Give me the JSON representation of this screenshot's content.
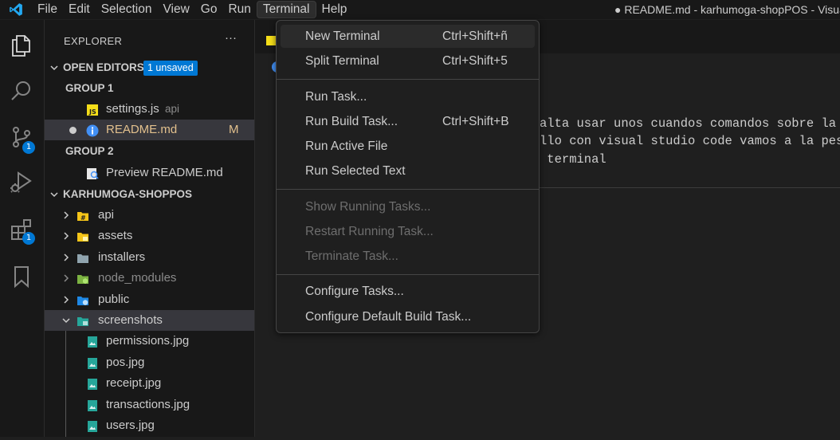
{
  "menubar": {
    "items": [
      "File",
      "Edit",
      "Selection",
      "View",
      "Go",
      "Run",
      "Terminal",
      "Help"
    ],
    "active": "Terminal"
  },
  "window_title": "● README.md - karhumoga-shopPOS - Visual Studio Code",
  "activity_bar": {
    "icons": [
      "explorer-icon",
      "search-icon",
      "source-control-icon",
      "run-debug-icon",
      "extensions-icon",
      "bookmarks-icon"
    ],
    "badges": {
      "source_control": "1",
      "extensions": "1"
    }
  },
  "explorer": {
    "title": "EXPLORER",
    "more": "···",
    "open_editors": {
      "label": "OPEN EDITORS",
      "badge": "1 unsaved",
      "group1": "GROUP 1",
      "group2": "GROUP 2",
      "files": [
        {
          "name": "settings.js",
          "desc": "api"
        },
        {
          "name": "README.md",
          "status": "M"
        },
        {
          "name": "Preview README.md"
        }
      ]
    },
    "project": {
      "label": "KARHUMOGA-SHOPPOS",
      "folders": [
        "api",
        "assets",
        "installers",
        "node_modules",
        "public",
        "screenshots"
      ],
      "files": [
        "permissions.jpg",
        "pos.jpg",
        "receipt.jpg",
        "transactions.jpg",
        "users.jpg"
      ]
    }
  },
  "editor": {
    "lines": [
      "alta usar unos cuandos comandos sobre la",
      "llo con visual studio code vamos a la pes",
      " terminal"
    ]
  },
  "terminal_menu": {
    "items": [
      {
        "label": "New Terminal",
        "shortcut": "Ctrl+Shift+ñ"
      },
      {
        "label": "Split Terminal",
        "shortcut": "Ctrl+Shift+5"
      },
      {
        "label": "Run Task...",
        "shortcut": ""
      },
      {
        "label": "Run Build Task...",
        "shortcut": "Ctrl+Shift+B"
      },
      {
        "label": "Run Active File",
        "shortcut": ""
      },
      {
        "label": "Run Selected Text",
        "shortcut": ""
      },
      {
        "label": "Show Running Tasks...",
        "shortcut": ""
      },
      {
        "label": "Restart Running Task...",
        "shortcut": ""
      },
      {
        "label": "Terminate Task...",
        "shortcut": ""
      },
      {
        "label": "Configure Tasks...",
        "shortcut": ""
      },
      {
        "label": "Configure Default Build Task...",
        "shortcut": ""
      }
    ]
  },
  "colors": {
    "accent": "#0078d4",
    "logo": "#23a9f2",
    "folder": "#90a4ae",
    "image_file": "#26a69a",
    "js": "#f5de19"
  }
}
